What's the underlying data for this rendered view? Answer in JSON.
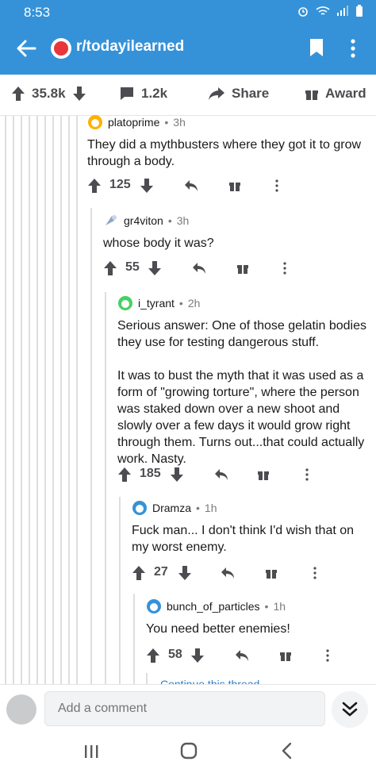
{
  "status_bar": {
    "time": "8:53",
    "icons": [
      "alarm-icon",
      "wifi-icon",
      "signal-icon",
      "battery-icon"
    ]
  },
  "app_bar": {
    "subreddit": "r/todayilearned"
  },
  "post_bar": {
    "upvotes": "35.8k",
    "comments": "1.2k",
    "share_label": "Share",
    "award_label": "Award"
  },
  "comments": [
    {
      "username": "platoprime",
      "age": "3h",
      "text": "They did a mythbusters where they got it to grow through a body.",
      "score": "125"
    },
    {
      "username": "gr4viton",
      "age": "3h",
      "text": "whose body it was?",
      "score": "55"
    },
    {
      "username": "i_tyrant",
      "age": "2h",
      "text": "Serious answer: One of those gelatin bodies they use for testing dangerous stuff.\n\nIt was to bust the myth that it was used as a form of \"growing torture\", where the person was staked down over a new shoot and slowly over a few days it would grow right through them. Turns out...that could actually work. Nasty.",
      "score": "185"
    },
    {
      "username": "Dramza",
      "age": "1h",
      "text": "Fuck man... I don't think I'd wish that on my worst enemy.",
      "score": "27"
    },
    {
      "username": "bunch_of_particles",
      "age": "1h",
      "text": "You need better enemies!",
      "score": "58"
    }
  ],
  "continue_thread": "Continue this thread",
  "comment_box": {
    "placeholder": "Add a comment"
  },
  "colors": {
    "app_bar": "#3592d8",
    "link": "#2e7ec6",
    "text": "#1a1a1b",
    "muted": "#7c7c7c"
  }
}
